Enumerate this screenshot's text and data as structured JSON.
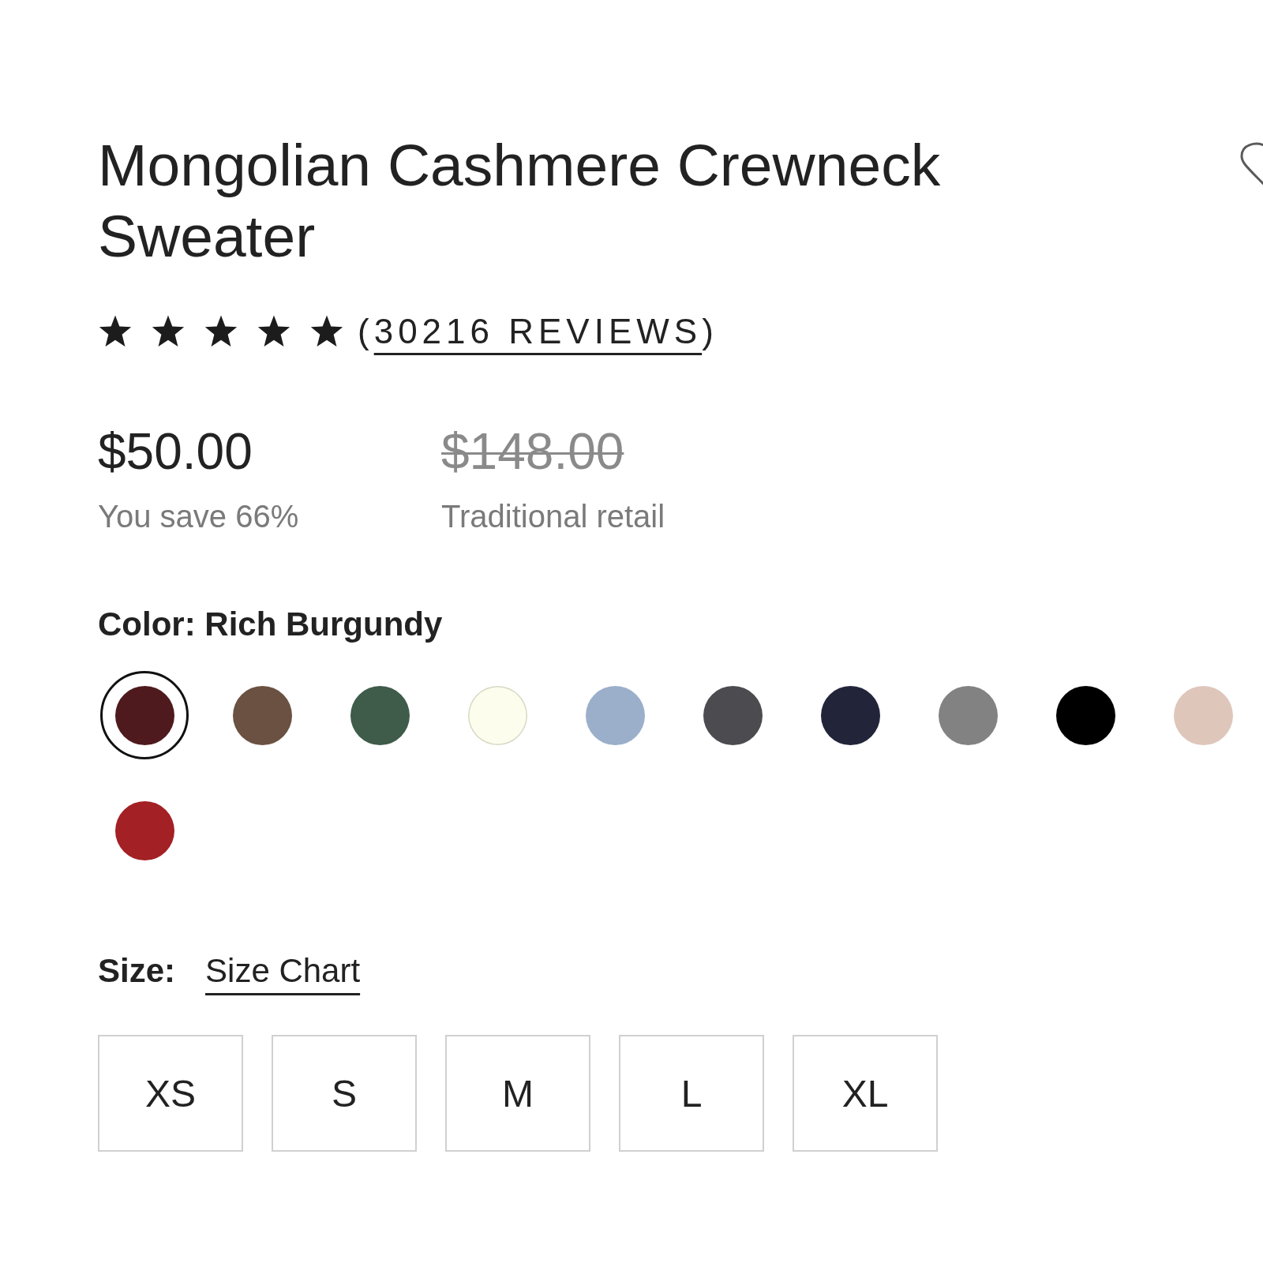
{
  "product": {
    "title": "Mongolian Cashmere Crewneck Sweater"
  },
  "rating": {
    "stars": 5,
    "reviews_prefix": "(",
    "reviews_link": "30216 REVIEWS",
    "reviews_suffix": ")"
  },
  "pricing": [
    {
      "kind": "sale",
      "amount": "$50.00",
      "note": "You save 66%"
    },
    {
      "kind": "original",
      "amount": "$148.00",
      "note": "Traditional retail"
    }
  ],
  "color": {
    "heading": "Color: Rich Burgundy",
    "swatches": [
      {
        "color": "#4e1a1d",
        "selected": true
      },
      {
        "color": "#6b5142",
        "selected": false
      },
      {
        "color": "#3f5b49",
        "selected": false
      },
      {
        "color": "#fdfdee",
        "selected": false
      },
      {
        "color": "#9bafca",
        "selected": false
      },
      {
        "color": "#4b4b50",
        "selected": false
      },
      {
        "color": "#22253a",
        "selected": false
      },
      {
        "color": "#828282",
        "selected": false
      },
      {
        "color": "#000000",
        "selected": false
      },
      {
        "color": "#dfc6bb",
        "selected": false
      },
      {
        "color": "#a32024",
        "selected": false
      }
    ]
  },
  "size": {
    "label": "Size:",
    "chart_link": "Size Chart",
    "options": [
      {
        "label": "XS",
        "selected": false
      },
      {
        "label": "S",
        "selected": false
      },
      {
        "label": "M",
        "selected": false
      },
      {
        "label": "L",
        "selected": false
      },
      {
        "label": "XL",
        "selected": false
      }
    ]
  }
}
